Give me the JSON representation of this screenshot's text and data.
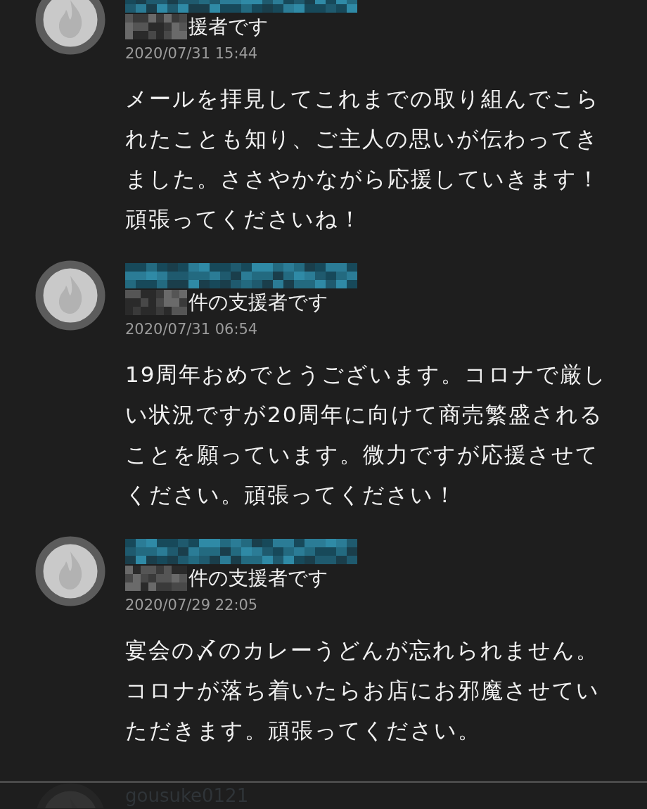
{
  "comments": [
    {
      "supporter": "援者です",
      "date": "2020/07/31 15:44",
      "body": "メールを拝見してこれまでの取り組んでこられたことも知り、ご主人の思いが伝わってきました。ささやかながら応援していきます！頑張ってくださいね！"
    },
    {
      "supporter": "件の支援者です",
      "date": "2020/07/31 06:54",
      "body": "19周年おめでとうございます。コロナで厳しい状況ですが20周年に向けて商売繁盛されることを願っています。微力ですが応援させてください。頑張ってください！"
    },
    {
      "supporter": "件の支援者です",
      "date": "2020/07/29 22:05",
      "body": "宴会の〆のカレーうどんが忘れられません。コロナが落ち着いたらお店にお邪魔させていただきます。頑張ってください。"
    }
  ],
  "next_comment": {
    "name": "gousuke0121"
  }
}
